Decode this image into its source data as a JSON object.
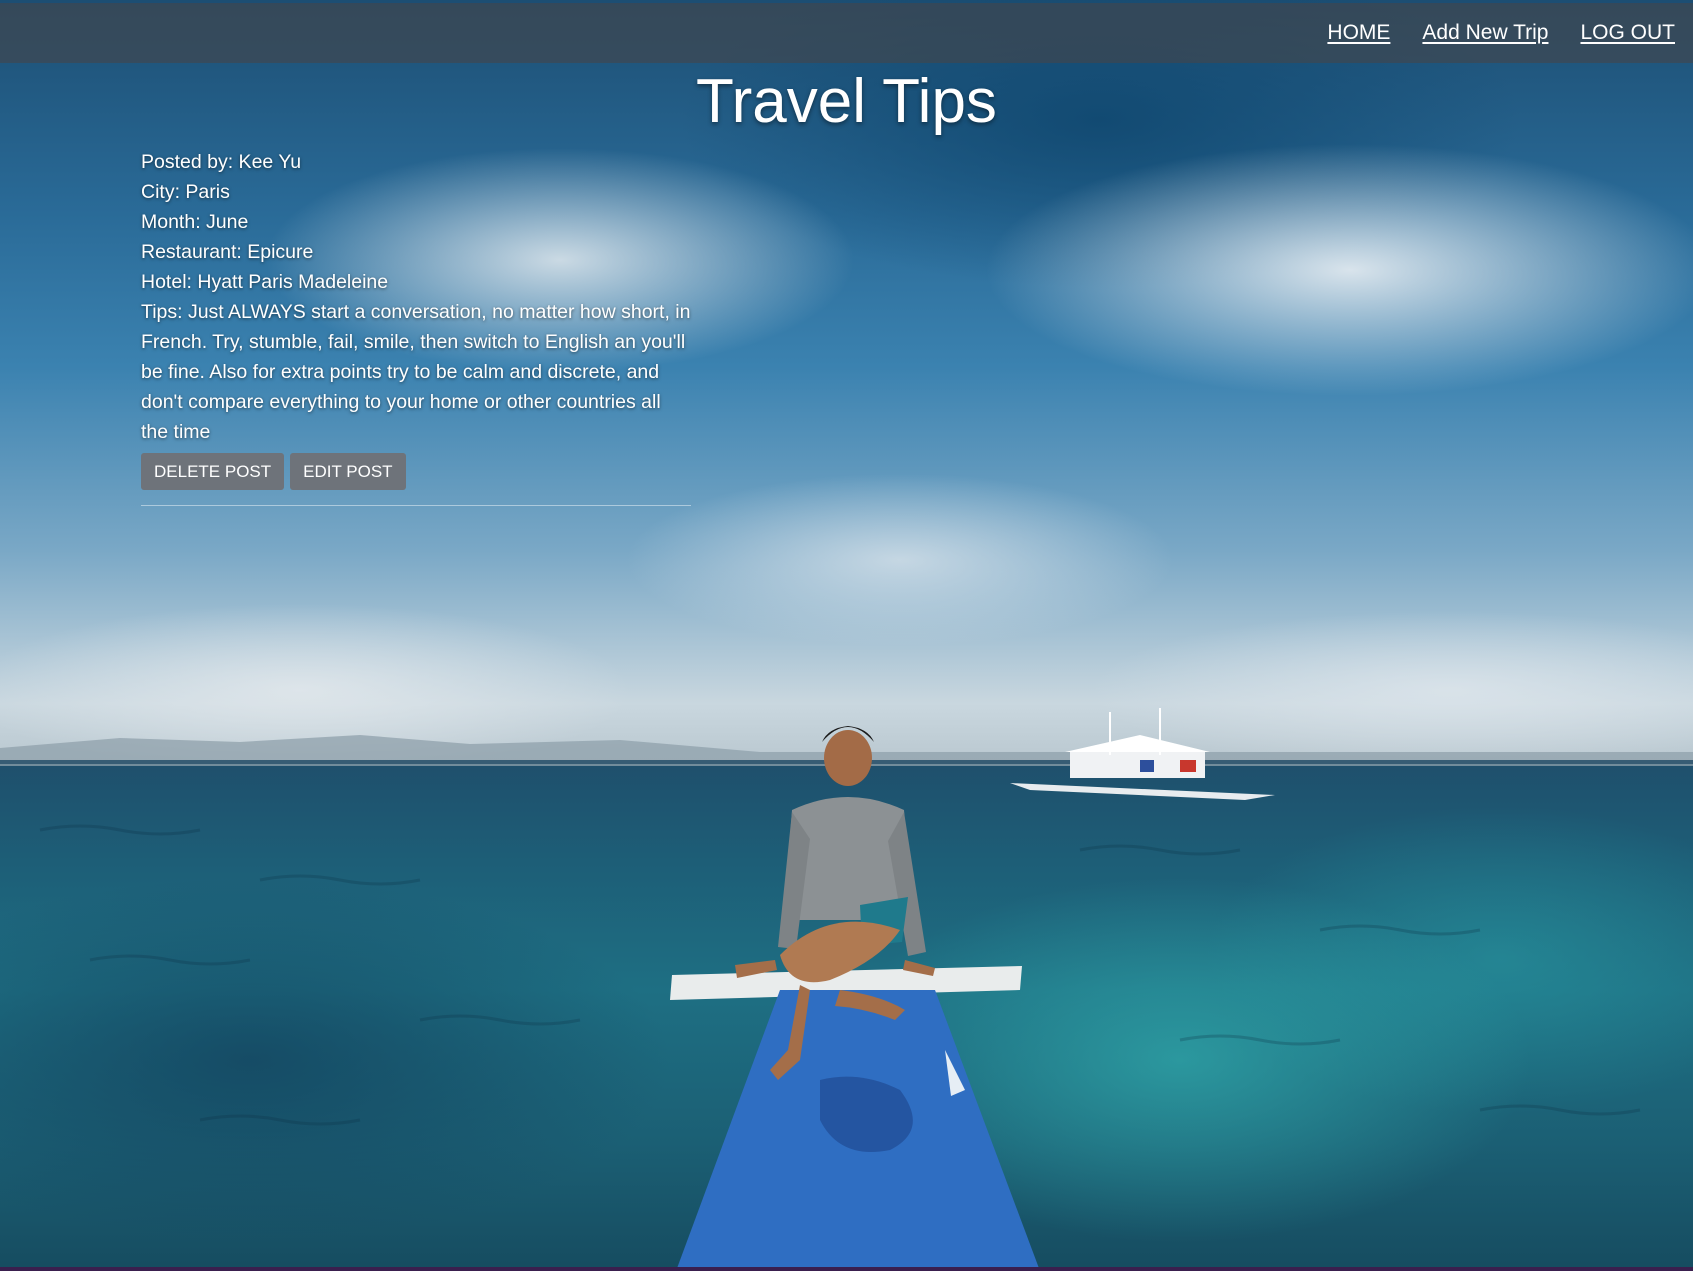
{
  "nav": {
    "home": "HOME",
    "add_trip": "Add New Trip",
    "logout": "LOG OUT"
  },
  "page_title": "Travel Tips",
  "post": {
    "posted_by": "Posted by: Kee Yu",
    "city": "City: Paris",
    "month": "Month: June",
    "restaurant": "Restaurant: Epicure",
    "hotel": "Hotel: Hyatt Paris Madeleine",
    "tips": "Tips: Just ALWAYS start a conversation, no matter how short, in French. Try, stumble, fail, smile, then switch to English an you'll be fine. Also for extra points try to be calm and discrete, and don't compare everything to your home or other countries all the time",
    "delete_label": "DELETE POST",
    "edit_label": "EDIT POST"
  },
  "colors": {
    "navbar": "#44464a",
    "button": "#6e737a",
    "text": "#ffffff"
  }
}
